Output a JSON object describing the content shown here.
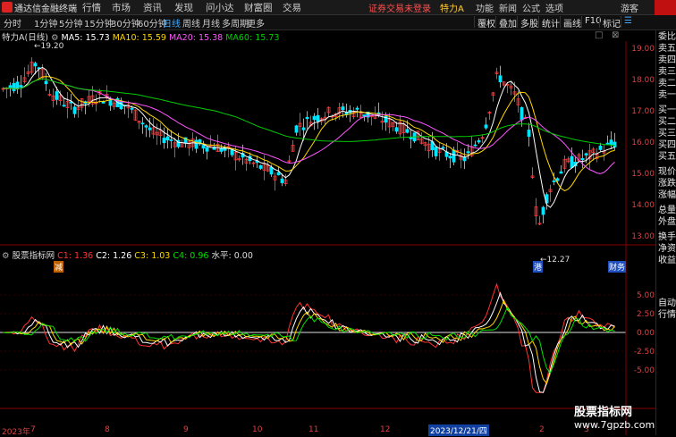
{
  "app_title": "通达信金融终端",
  "menu": [
    "行情",
    "市场",
    "资讯",
    "发现",
    "问小达",
    "财富圈",
    "交易"
  ],
  "notice": "证券交易未登录",
  "stock_name": "特力A",
  "right_menu": [
    "功能",
    "新闻",
    "公式",
    "选项",
    "游客"
  ],
  "periods": [
    "分时",
    "1分钟",
    "5分钟",
    "15分钟",
    "30分钟",
    "60分钟",
    "日线",
    "周线",
    "月线",
    "多周期",
    "更多"
  ],
  "active_period": "日线",
  "tools": [
    "叠加",
    "多股",
    "统计",
    "画线",
    "F10",
    "标记"
  ],
  "first_tool": "覆权",
  "main_header": {
    "symbol": "特力A(日线)",
    "ma5": "MA5: 15.73",
    "ma10": "MA10: 15.59",
    "ma20": "MA20: 15.38",
    "ma60": "MA60: 15.73"
  },
  "price_axis": [
    "19.00",
    "18.00",
    "17.00",
    "16.00",
    "15.00",
    "14.00",
    "13.00"
  ],
  "high_label": "19.20",
  "low_label": "12.27",
  "markers": {
    "left": "减",
    "mid": "港",
    "right": "财务"
  },
  "indicator_header": {
    "name": "股票指标网",
    "c1": "C1: 1.36",
    "c2": "C2: 1.26",
    "c3": "C3: 1.03",
    "c4": "C4: 0.96",
    "level": "水平: 0.00"
  },
  "indicator_axis": [
    "5.00",
    "2.50",
    "0.00",
    "-2.50",
    "-5.00"
  ],
  "date_axis": [
    "2023年",
    "7",
    "8",
    "9",
    "10",
    "11",
    "12",
    "2023/12/21/四",
    "2",
    "3"
  ],
  "right_panel": [
    "委比",
    "卖五",
    "卖四",
    "卖三",
    "卖二",
    "卖一",
    "买一",
    "买二",
    "买三",
    "买四",
    "买五",
    "现价",
    "涨跌",
    "涨幅",
    "总量",
    "外盘",
    "换手",
    "净资",
    "收益",
    "",
    "自动",
    "行情"
  ],
  "watermark": {
    "line1": "股票指标网",
    "line2": "www.7gpzb.com"
  },
  "colors": {
    "up": "#ff3333",
    "down": "#00e5ff",
    "ma5": "#ffffff",
    "ma10": "#ffd700",
    "ma20": "#ff55ff",
    "ma60": "#00cc00"
  }
}
